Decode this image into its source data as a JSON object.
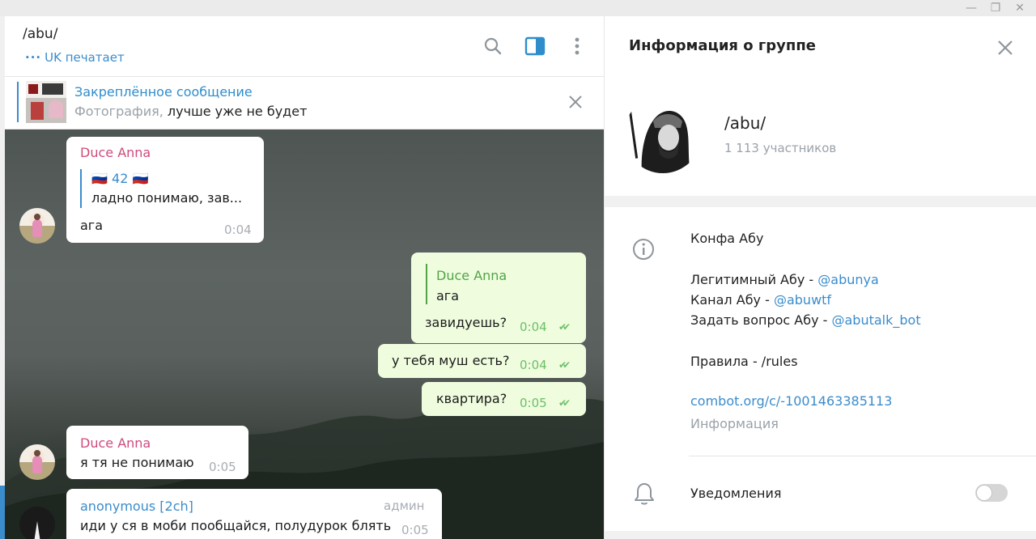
{
  "colors": {
    "accent": "#3a8ccc",
    "outgoing_bubble": "#effdde",
    "sender_pink": "#cf4a7d",
    "sender_green": "#52a447",
    "sender_blue": "#3a8ccc"
  },
  "chat": {
    "title": "/abu/",
    "typing_status": "UK печатает",
    "header_icons": [
      "search-icon",
      "sidebar-toggle-icon",
      "more-vertical-icon"
    ],
    "pinned": {
      "title": "Закреплённое сообщение",
      "type_label": "Фотография,",
      "text": " лучше уже не будет"
    },
    "messages": [
      {
        "sender": "Duce Anna",
        "reply_name": "🇷🇺 42 🇷🇺",
        "reply_text": "ладно понимаю, зав...",
        "text": "ага",
        "time": "0:04"
      },
      {
        "sender": "Duce Anna",
        "text": "ага",
        "second_text": "завидуешь?",
        "time": "0:04",
        "outgoing": true
      },
      {
        "text": "у тебя муш есть?",
        "time": "0:04",
        "outgoing": true
      },
      {
        "text": "квартира?",
        "time": "0:05",
        "outgoing": true
      },
      {
        "sender": "Duce Anna",
        "text": "я тя не понимаю",
        "time": "0:05"
      },
      {
        "sender": "anonymous [2ch]",
        "badge": "админ",
        "text": "иди у ся в моби пообщайся, полудурок блять",
        "time": "0:05"
      }
    ]
  },
  "info": {
    "title": "Информация о группе",
    "group_name": "/abu/",
    "members": "1 113 участников",
    "description": {
      "line1": "Конфа Абу",
      "line2_prefix": "Легитимный Абу - ",
      "line2_link": "@abunya",
      "line3_prefix": "Канал Абу - ",
      "line3_link": "@abuwtf",
      "line4_prefix": "Задать вопрос Абу - ",
      "line4_link": "@abutalk_bot",
      "line5": "Правила - /rules"
    },
    "link": "combot.org/c/-1001463385113",
    "link_caption": "Информация",
    "notifications_label": "Уведомления",
    "notifications_on": false
  }
}
